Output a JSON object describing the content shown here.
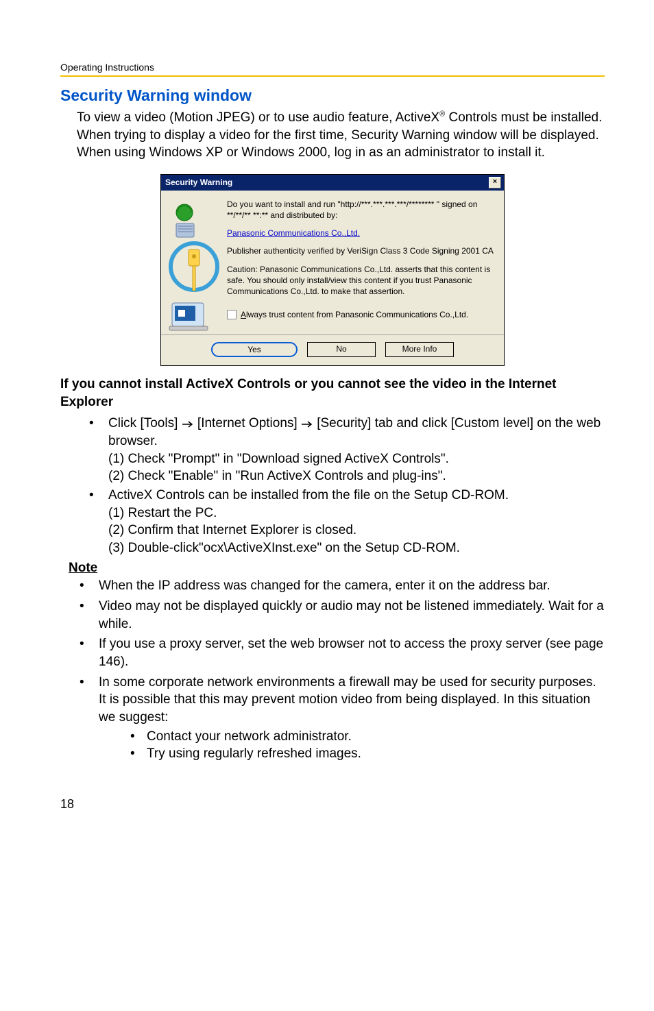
{
  "header": {
    "text": "Operating Instructions"
  },
  "section": {
    "title": "Security Warning window",
    "intro_parts": {
      "p1a": "To view a video (Motion JPEG) or to use audio feature, ActiveX",
      "reg": "®",
      "p1b": " Controls must be installed. When trying to display a video for the first time, Security Warning window will be displayed. When using Windows XP or Windows 2000, log in as an administrator to install it."
    }
  },
  "dialog": {
    "title": "Security Warning",
    "close": "×",
    "line1": "Do you want to install and run \"http://***.***.***.***/******** \" signed on **/**/** **:** and distributed by:",
    "link": "Panasonic Communications Co.,Ltd.",
    "line2": "Publisher authenticity verified by VeriSign Class 3 Code Signing 2001 CA",
    "line3": "Caution: Panasonic Communications Co.,Ltd. asserts that this content is safe.  You should only install/view this content if you trust Panasonic Communications Co.,Ltd. to make that assertion.",
    "check_underline": "A",
    "check_rest": "lways trust content from Panasonic Communications Co.,Ltd.",
    "btn_yes": "Yes",
    "btn_no": "No",
    "btn_more": "More Info"
  },
  "subheading": "If you cannot install ActiveX Controls or you cannot see the video in the Internet Explorer",
  "bullets": [
    {
      "pre": "Click [Tools]",
      "mid": "[Internet Options]",
      "post": "[Security] tab and click [Custom level] on the web browser.",
      "subs": [
        "(1) Check \"Prompt\" in \"Download signed ActiveX Controls\".",
        "(2) Check \"Enable\" in \"Run ActiveX Controls and plug-ins\"."
      ]
    },
    {
      "text": "ActiveX Controls can be installed from the file on the Setup CD-ROM.",
      "subs": [
        "(1) Restart the PC.",
        "(2) Confirm that Internet Explorer is closed.",
        "(3) Double-click\"ocx\\ActiveXInst.exe\" on the Setup CD-ROM."
      ]
    }
  ],
  "note": {
    "label": "Note",
    "items": [
      {
        "text": "When the IP address was changed for the camera, enter it on the address bar."
      },
      {
        "text": "Video may not be displayed quickly or audio may not be listened immediately. Wait for a while."
      },
      {
        "text": "If you use a proxy server, set the web browser not to access the proxy server (see page 146)."
      },
      {
        "text": "In some corporate network environments a firewall may be used for security purposes. It is possible that this may prevent motion video from being displayed. In this situation we suggest:",
        "inner": [
          "Contact your network administrator.",
          "Try using regularly refreshed images."
        ]
      }
    ]
  },
  "pagenum": "18"
}
